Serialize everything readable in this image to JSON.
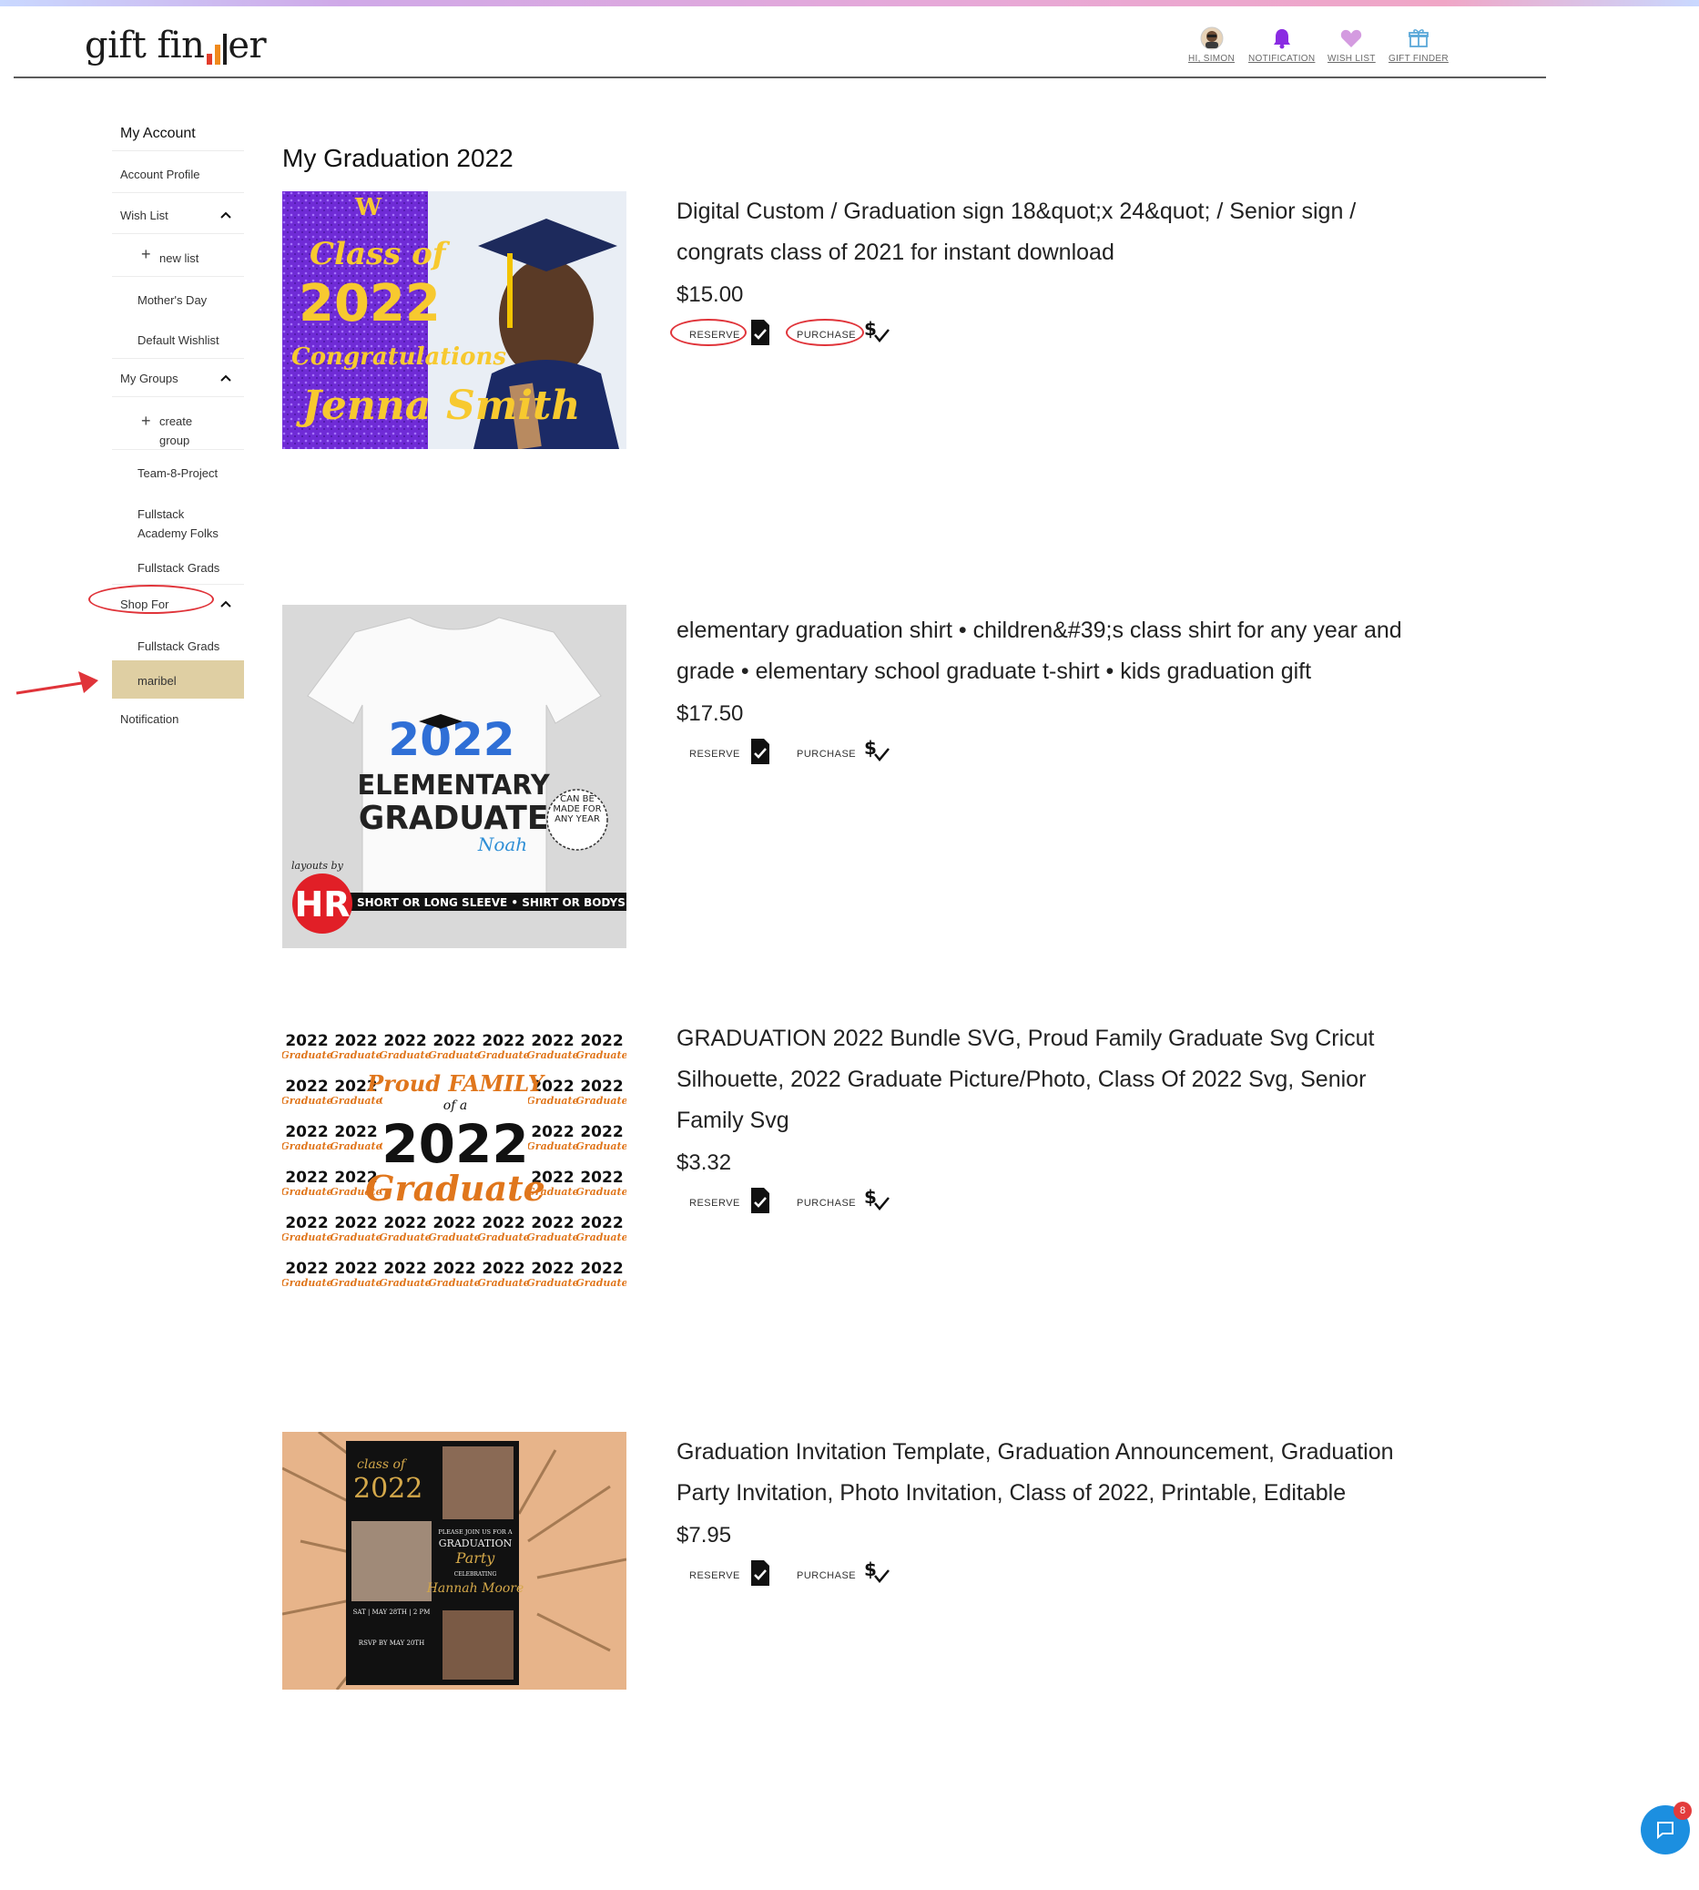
{
  "brand": {
    "logo_text_1": "gift fin",
    "logo_text_2": "er"
  },
  "nav": [
    {
      "label": "HI, SIMON",
      "icon": "avatar-icon"
    },
    {
      "label": "NOTIFICATION",
      "icon": "bell-icon"
    },
    {
      "label": "WISH LIST",
      "icon": "heart-icon"
    },
    {
      "label": "GIFT FINDER",
      "icon": "gift-icon"
    }
  ],
  "sidebar": {
    "title": "My Account",
    "account_profile": "Account Profile",
    "wish_list": "Wish List",
    "new_list": "new list",
    "mothers_day": "Mother's Day",
    "default_wishlist": "Default Wishlist",
    "my_groups": "My Groups",
    "create_group_1": "create",
    "create_group_2": "group",
    "team_project": "Team-8-Project",
    "fullstack_folks_1": "Fullstack",
    "fullstack_folks_2": "Academy Folks",
    "fullstack_grads": "Fullstack Grads",
    "shop_for": "Shop For",
    "shop_fullstack_grads": "Fullstack Grads",
    "maribel": "maribel",
    "notification": "Notification"
  },
  "main": {
    "title": "My Graduation 2022",
    "reserve_label": "RESERVE",
    "purchase_label": "PURCHASE",
    "products": [
      {
        "name": "Digital Custom / Graduation sign 18&quot;x 24&quot; / Senior sign / congrats class of 2021 for instant download",
        "price": "$15.00",
        "img": {
          "line1": "Class of",
          "line2": "2022",
          "line3": "Congratulations",
          "line4": "Jenna",
          "line5": "Smith",
          "badge": "W"
        }
      },
      {
        "name": "elementary graduation shirt • children&#39;s class shirt for any year and grade • elementary school graduate t-shirt • kids graduation gift",
        "price": "$17.50",
        "img": {
          "year": "2022",
          "line1": "ELEMENTARY",
          "line2": "GRADUATE",
          "line3": "Noah",
          "stamp": "CAN BE MADE FOR ANY YEAR",
          "banner": "SHORT OR LONG SLEEVE • SHIRT OR BODYSUIT",
          "sig": "layouts by"
        }
      },
      {
        "name": "GRADUATION 2022 Bundle SVG, Proud Family Graduate Svg Cricut Silhouette, 2022 Graduate Picture/Photo, Class Of 2022 Svg, Senior Family Svg",
        "price": "$3.32",
        "img": {
          "line1": "Proud FAMILY",
          "line2": "of a",
          "line3": "2022",
          "line4": "Graduate",
          "tile_year": "2022",
          "tile_word": "Graduate"
        }
      },
      {
        "name": "Graduation Invitation Template, Graduation Announcement, Graduation Party Invitation, Photo Invitation, Class of 2022, Printable, Editable",
        "price": "$7.95",
        "img": {
          "line1": "class of",
          "line2": "2022",
          "line3": "PLEASE JOIN US FOR A",
          "line4": "GRADUATION",
          "line5": "Party",
          "line6": "CELEBRATING",
          "line7": "Hannah Moore",
          "line8": "SAT | MAY 28TH | 2 PM",
          "line9": "RSVP BY MAY 20TH"
        }
      }
    ]
  },
  "chat": {
    "badge": "8"
  },
  "colors": {
    "accent_red": "#e0343a",
    "selected_bg": "#dfcfa3",
    "chat_blue": "#1c8fe0"
  }
}
